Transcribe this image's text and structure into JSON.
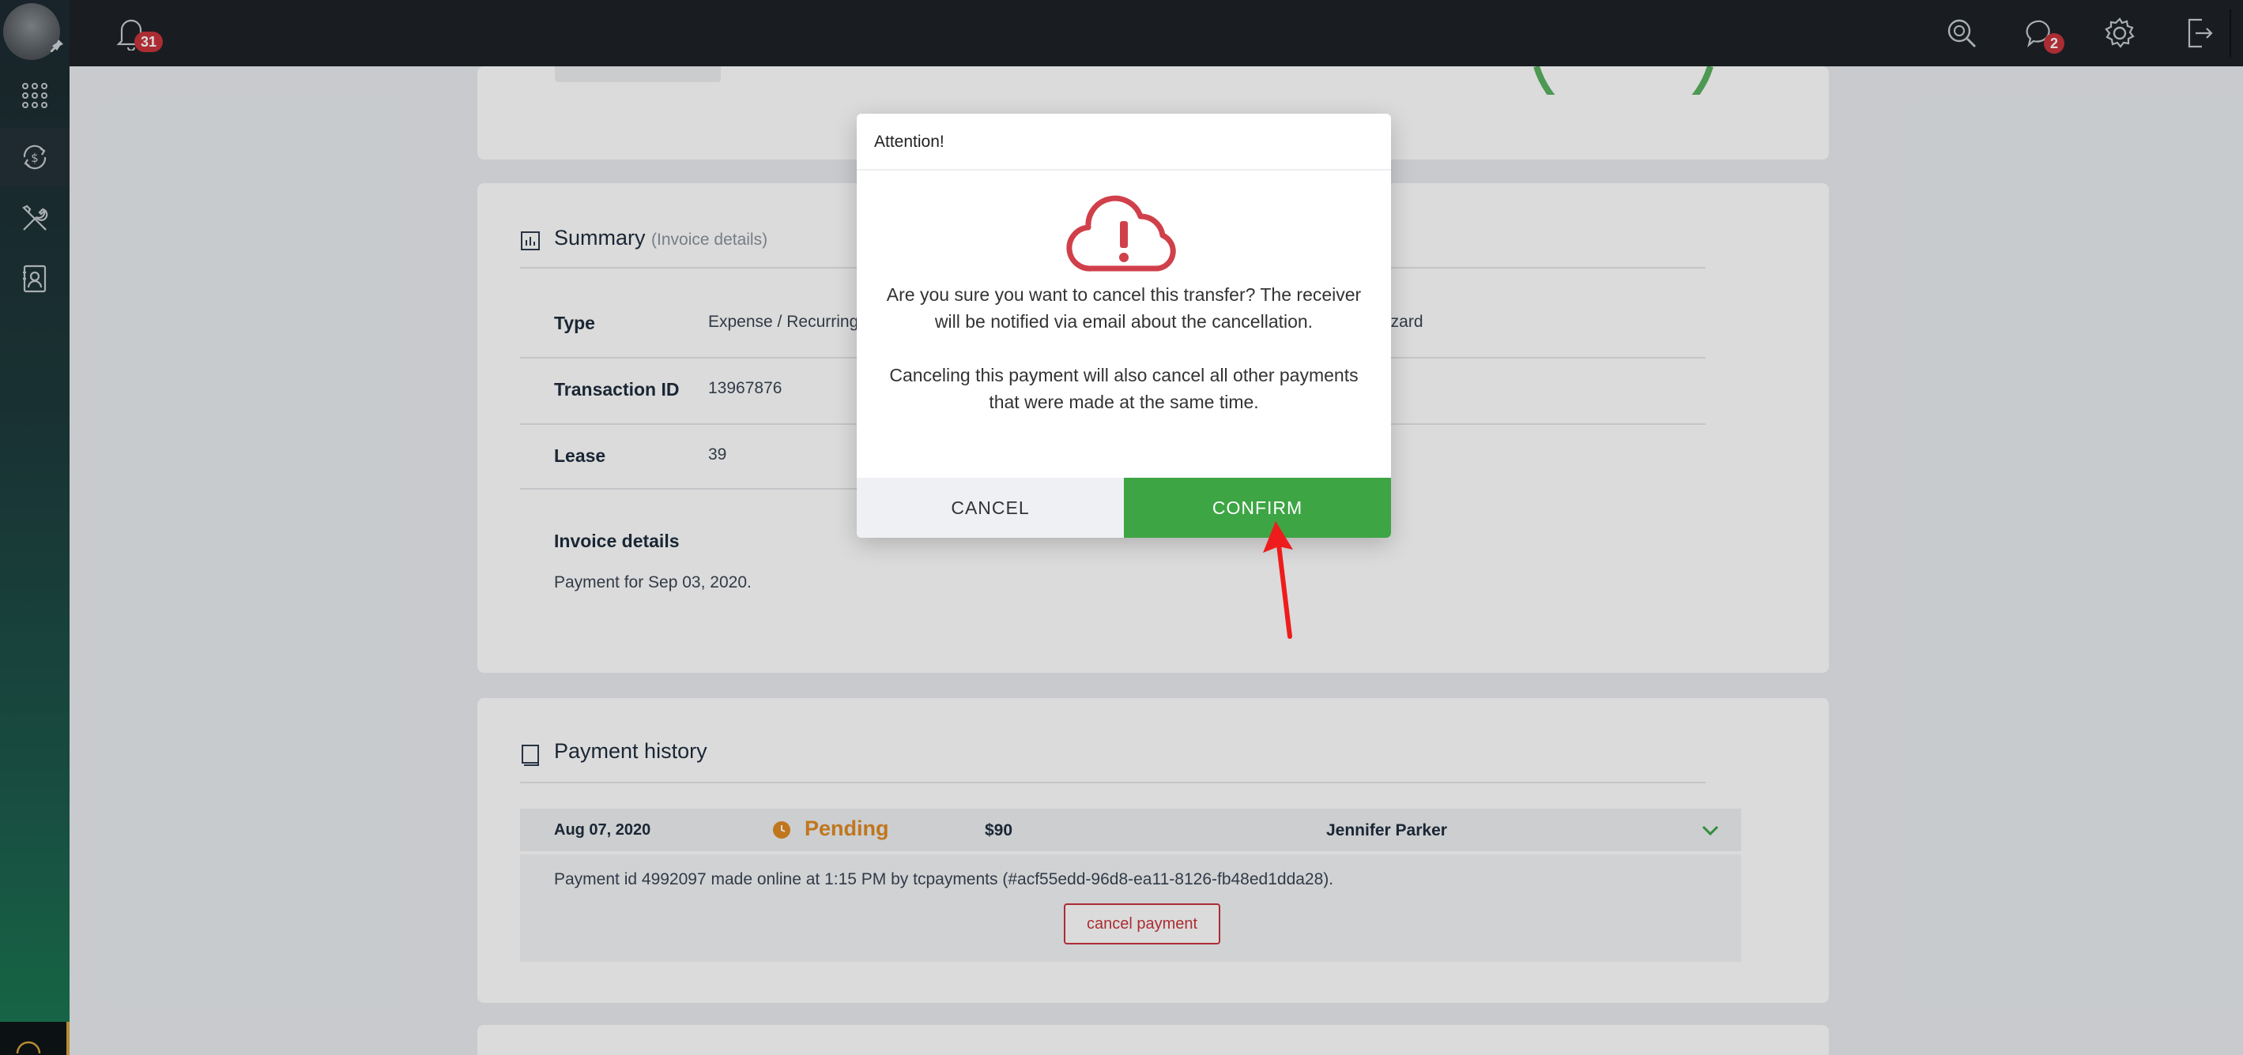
{
  "topbar": {
    "notifications_count": "31",
    "messages_count": "2"
  },
  "summary": {
    "title": "Summary",
    "subtitle": "(Invoice details)",
    "rows": [
      {
        "label": "Type",
        "value": "Expense / Recurring",
        "extra": "y lizard"
      },
      {
        "label": "Transaction ID",
        "value": "13967876"
      },
      {
        "label": "Lease",
        "value": "39"
      }
    ],
    "invoice_details_label": "Invoice details",
    "invoice_details_value": "Payment for Sep 03, 2020."
  },
  "payment_history": {
    "title": "Payment history",
    "row": {
      "date": "Aug 07, 2020",
      "status": "Pending",
      "amount": "$90",
      "name": "Jennifer Parker"
    },
    "detail": "Payment id 4992097 made online at 1:15 PM by tcpayments (#acf55edd-96d8-ea11-8126-fb48ed1dda28).",
    "cancel_button": "cancel payment"
  },
  "modal": {
    "title": "Attention!",
    "message_1": "Are you sure you want to cancel this transfer? The receiver will be notified via email about the cancellation.",
    "message_2": "Canceling this payment will also cancel all other payments that were made at the same time.",
    "cancel_label": "CANCEL",
    "confirm_label": "CONFIRM"
  },
  "colors": {
    "accent_green": "#3da544",
    "danger_red": "#c7353c",
    "pending_orange": "#e08a22"
  }
}
